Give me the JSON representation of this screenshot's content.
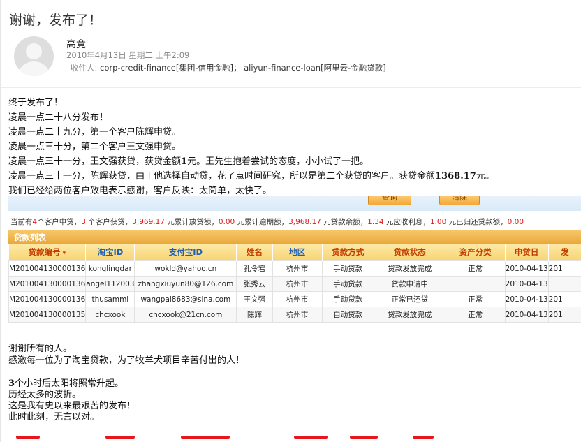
{
  "email": {
    "subject": "谢谢，发布了！",
    "sender": "高竟",
    "date": "2010年4月13日 星期二 上午2:09",
    "recipients_label": "收件人:",
    "recipients": "corp-credit-finance[集团-信用金融]；  aliyun-finance-loan[阿里云-金融贷款]"
  },
  "body": {
    "line1": "终于发布了！",
    "line2": "凌晨一点二十八分发布！",
    "line3": "凌晨一点二十九分，第一个客户陈辉申贷。",
    "line4": "凌晨一点三十分，第二个客户王文强申贷。",
    "line5_a": "凌晨一点三十一分，王文强获贷，获贷金额",
    "line5_num": "1",
    "line5_b": "元。王先生抱着尝试的态度，小小试了一把。",
    "line6_a": "凌晨一点三十一分，陈辉获贷，由于他选择自动贷，花了点时间研究，所以是第二个获贷的客户。获贷金额",
    "line6_num": "1368.17",
    "line6_b": "元。",
    "line7": "我们已经给两位客户致电表示感谢，客户反映：太简单，太快了。",
    "line8": "谢谢所有的人。",
    "line9": "感激每一位为了淘宝贷款，为了牧羊犬项目辛苦付出的人！",
    "line10_num": "3",
    "line10": "个小时后太阳将照常升起。",
    "line11": "历经太多的波折。",
    "line12": "这是我有史以来最艰苦的发布！",
    "line13": "此时此刻，无言以对。"
  },
  "screenshot": {
    "btn_query": "查询",
    "btn_clear": "清除",
    "summary": {
      "t1": "当前有",
      "n1": "4",
      "t2": "个客户申贷，",
      "n2": "3",
      "t3": " 个客户获贷，",
      "n3": "3,969.17",
      "t4": " 元累计放贷额，",
      "n4": "0.00",
      "t5": " 元累计逾期额，",
      "n5": "3,968.17",
      "t6": " 元贷款余额，",
      "n6": "1.34",
      "t7": " 元应收利息，",
      "n7": "1.00",
      "t8": " 元已归还贷款额，",
      "n8": "0.00"
    },
    "list_title": "贷款列表",
    "columns": [
      "贷款编号",
      "淘宝ID",
      "支付宝ID",
      "姓名",
      "地区",
      "贷款方式",
      "贷款状态",
      "资产分类",
      "申贷日",
      "发"
    ],
    "rows": [
      {
        "id": "M201004130000136",
        "taobao": "konglingdar",
        "alipay": "wokld@yahoo.cn",
        "name": "孔令宕",
        "region": "杭州市",
        "method": "手动贷款",
        "status": "贷款发放完成",
        "asset": "正常",
        "date": "2010-04-13",
        "extra": "201"
      },
      {
        "id": "M201004130000136",
        "taobao": "angel112003",
        "alipay": "zhangxiuyun80@126.com",
        "name": "张秀云",
        "region": "杭州市",
        "method": "手动贷款",
        "status": "贷款申请中",
        "asset": "",
        "date": "2010-04-13",
        "extra": ""
      },
      {
        "id": "M201004130000136",
        "taobao": "thusammi",
        "alipay": "wangpai8683@sina.com",
        "name": "王文强",
        "region": "杭州市",
        "method": "手动贷款",
        "status": "正常已还贷",
        "asset": "正常",
        "date": "2010-04-13",
        "extra": "201"
      },
      {
        "id": "M201004130000135",
        "taobao": "chcxook",
        "alipay": "chcxook@21cn.com",
        "name": "陈辉",
        "region": "杭州市",
        "method": "自动贷款",
        "status": "贷款发放完成",
        "asset": "正常",
        "date": "2010-04-13",
        "extra": "201"
      }
    ]
  },
  "colors": {
    "accent_red": "#e0161b",
    "header_orange": "#f4a93a",
    "link_blue": "#1f5fb5"
  },
  "icons": [
    "avatar-placeholder-icon",
    "sort-arrow-icon"
  ]
}
